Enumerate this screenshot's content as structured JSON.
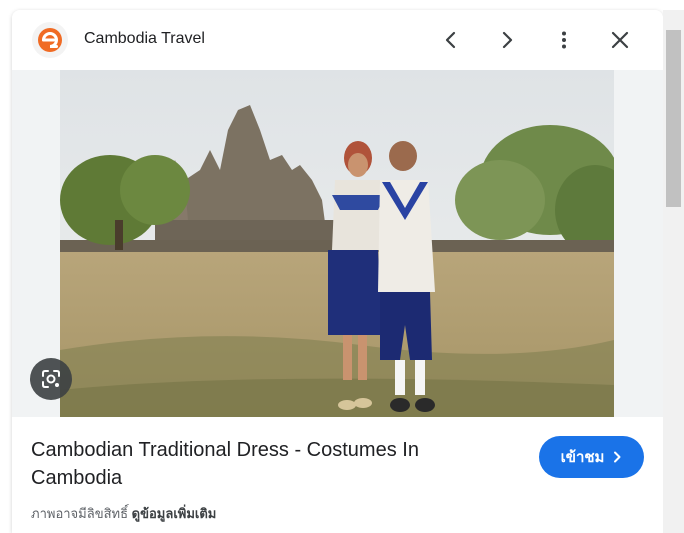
{
  "header": {
    "site_name": "Cambodia Travel",
    "logo_icon": "orange-e-logo-icon",
    "prev_icon": "chevron-left-icon",
    "next_icon": "chevron-right-icon",
    "menu_icon": "more-vert-icon",
    "close_icon": "close-icon"
  },
  "image": {
    "lens_icon": "google-lens-icon"
  },
  "content": {
    "title": "Cambodian Traditional Dress - Costumes In Cambodia",
    "visit_label": "เข้าชม",
    "copyright_text": "ภาพอาจมีลิขสิทธิ์",
    "more_info_label": "ดูข้อมูลเพิ่มเติม"
  },
  "colors": {
    "accent": "#1a73e8",
    "logo_orange": "#f06b24"
  }
}
